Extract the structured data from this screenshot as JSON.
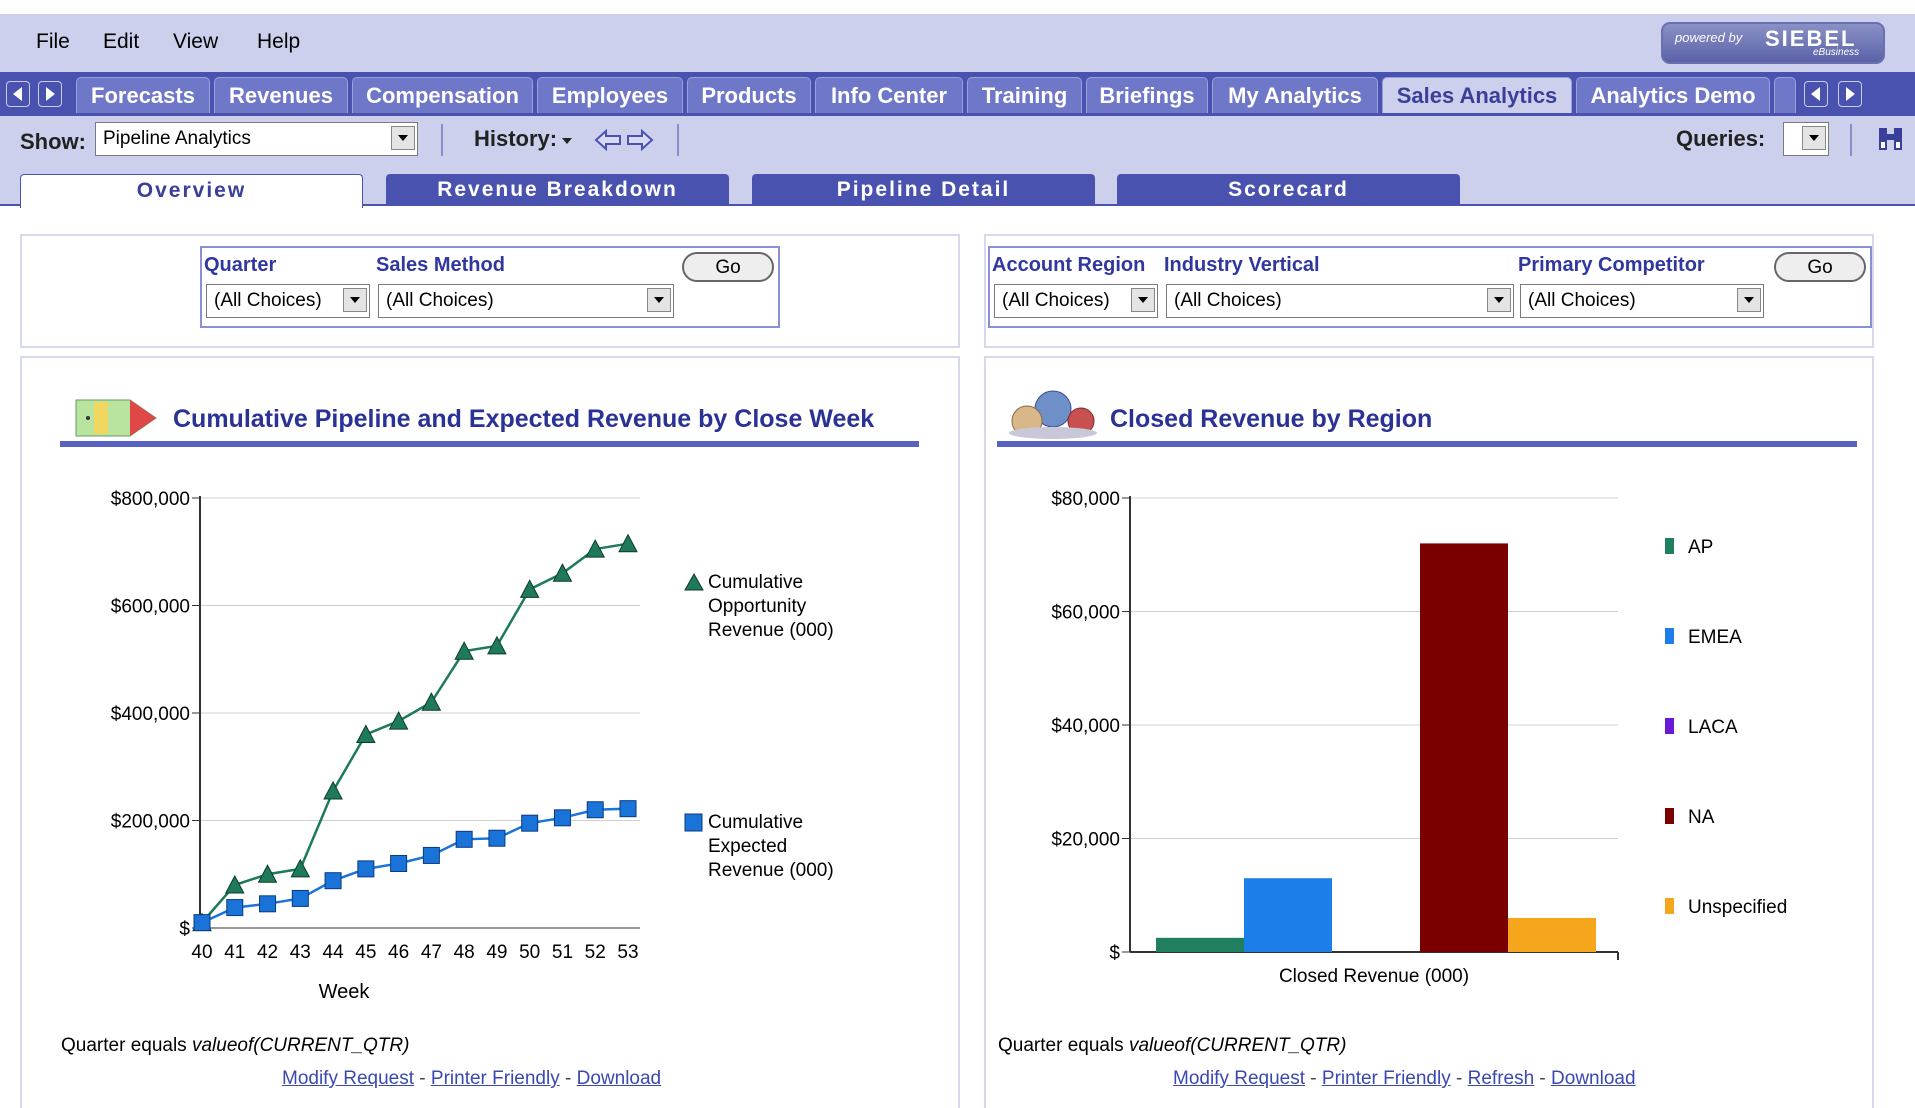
{
  "menu": {
    "file": "File",
    "edit": "Edit",
    "view": "View",
    "help": "Help"
  },
  "logo": {
    "powered_by": "powered by",
    "brand": "SIEBEL",
    "sub": "eBusiness"
  },
  "tabs": [
    {
      "label": "Forecasts"
    },
    {
      "label": "Revenues"
    },
    {
      "label": "Compensation"
    },
    {
      "label": "Employees"
    },
    {
      "label": "Products"
    },
    {
      "label": "Info Center"
    },
    {
      "label": "Training"
    },
    {
      "label": "Briefings"
    },
    {
      "label": "My Analytics"
    },
    {
      "label": "Sales Analytics",
      "active": true
    },
    {
      "label": "Analytics Demo"
    }
  ],
  "showbar": {
    "show_label": "Show:",
    "show_value": "Pipeline Analytics",
    "history_label": "History:",
    "queries_label": "Queries:"
  },
  "subtabs": [
    {
      "label": "Overview",
      "active": true
    },
    {
      "label": "Revenue Breakdown"
    },
    {
      "label": "Pipeline Detail"
    },
    {
      "label": "Scorecard"
    }
  ],
  "left_prompts": {
    "quarter_label": "Quarter",
    "quarter_value": "(All Choices)",
    "sales_method_label": "Sales Method",
    "sales_method_value": "(All Choices)",
    "go": "Go"
  },
  "right_prompts": {
    "account_region_label": "Account Region",
    "account_region_value": "(All Choices)",
    "industry_label": "Industry Vertical",
    "industry_value": "(All Choices)",
    "competitor_label": "Primary Competitor",
    "competitor_value": "(All Choices)",
    "go": "Go"
  },
  "left_report": {
    "filter_prefix": "Quarter equals ",
    "filter_value": "valueof(CURRENT_QTR)",
    "links": {
      "modify": "Modify Request",
      "printer": "Printer Friendly",
      "download": "Download"
    }
  },
  "right_report": {
    "filter_prefix": "Quarter equals ",
    "filter_value": "valueof(CURRENT_QTR)",
    "links": {
      "modify": "Modify Request",
      "printer": "Printer Friendly",
      "refresh": "Refresh",
      "download": "Download"
    }
  },
  "colors": {
    "tab_bar": "#4a52b0",
    "header_bg": "#cdd0ec",
    "title_blue": "#2a3296"
  },
  "chart_data": [
    {
      "type": "line",
      "title": "Cumulative Pipeline and Expected Revenue by Close Week",
      "xlabel": "Week",
      "ylabel": "",
      "x": [
        40,
        41,
        42,
        43,
        44,
        45,
        46,
        47,
        48,
        49,
        50,
        51,
        52,
        53
      ],
      "ylim": [
        0,
        800000
      ],
      "yticks": [
        0,
        200000,
        400000,
        600000,
        800000
      ],
      "ytick_labels": [
        "$",
        "$200,000",
        "$400,000",
        "$600,000",
        "$800,000"
      ],
      "grid": true,
      "legend": "right",
      "series": [
        {
          "name": "Cumulative Opportunity Revenue (000)",
          "marker": "triangle",
          "color": "#1e7a5a",
          "values": [
            10000,
            80000,
            100000,
            110000,
            255000,
            360000,
            385000,
            420000,
            515000,
            525000,
            630000,
            660000,
            705000,
            715000
          ]
        },
        {
          "name": "Cumulative Expected Revenue (000)",
          "marker": "square",
          "color": "#1a73d9",
          "values": [
            10000,
            38000,
            45000,
            55000,
            88000,
            110000,
            120000,
            135000,
            165000,
            167000,
            195000,
            205000,
            220000,
            222000
          ]
        }
      ]
    },
    {
      "type": "bar",
      "title": "Closed Revenue by Region",
      "xlabel": "Closed Revenue (000)",
      "ylabel": "",
      "ylim": [
        0,
        80000
      ],
      "yticks": [
        0,
        20000,
        40000,
        60000,
        80000
      ],
      "ytick_labels": [
        "$",
        "$20,000",
        "$40,000",
        "$60,000",
        "$80,000"
      ],
      "grid": true,
      "legend": "right",
      "series": [
        {
          "name": "AP",
          "color": "#1f7f5f",
          "value": 2500
        },
        {
          "name": "EMEA",
          "color": "#1c7ee8",
          "value": 13000
        },
        {
          "name": "LACA",
          "color": "#6a1ad6",
          "value": 0
        },
        {
          "name": "NA",
          "color": "#7a0000",
          "value": 72000
        },
        {
          "name": "Unspecified",
          "color": "#f6a61c",
          "value": 6000
        }
      ]
    }
  ]
}
